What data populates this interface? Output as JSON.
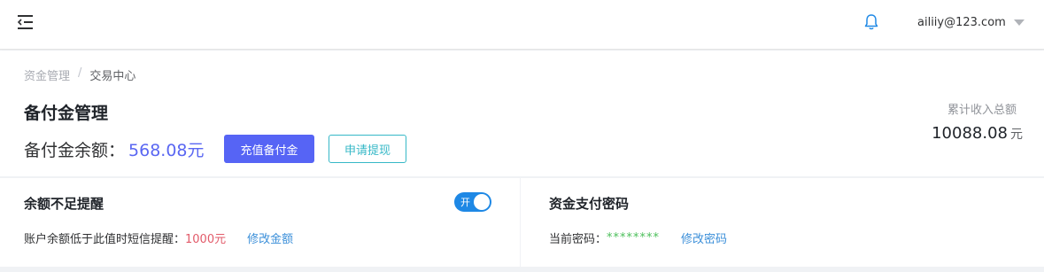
{
  "header": {
    "user_email": "ailiiy@123.com"
  },
  "breadcrumb": {
    "parent": "资金管理",
    "separator": "/",
    "current": "交易中心"
  },
  "page": {
    "title": "备付金管理",
    "balance_label": "备付金余额：",
    "balance_value": "568.08元",
    "recharge_button": "充值备付金",
    "withdraw_button": "申请提现",
    "income_label": "累计收入总额",
    "income_value": "10088.08",
    "income_unit": "元"
  },
  "reminder": {
    "title": "余额不足提醒",
    "toggle_label": "开",
    "toggle_on": true,
    "description": "账户余额低于此值时短信提醒：",
    "threshold": "1000元",
    "edit_link": "修改金额"
  },
  "password": {
    "title": "资金支付密码",
    "label": "当前密码：",
    "masked_value": "********",
    "edit_link": "修改密码"
  },
  "colors": {
    "primary": "#5664f5",
    "accent_teal": "#36b8c7",
    "toggle_blue": "#1e88e5",
    "link_blue": "#3b8fd9",
    "threshold_red": "#e25b6a",
    "password_green": "#4bbf5a"
  }
}
